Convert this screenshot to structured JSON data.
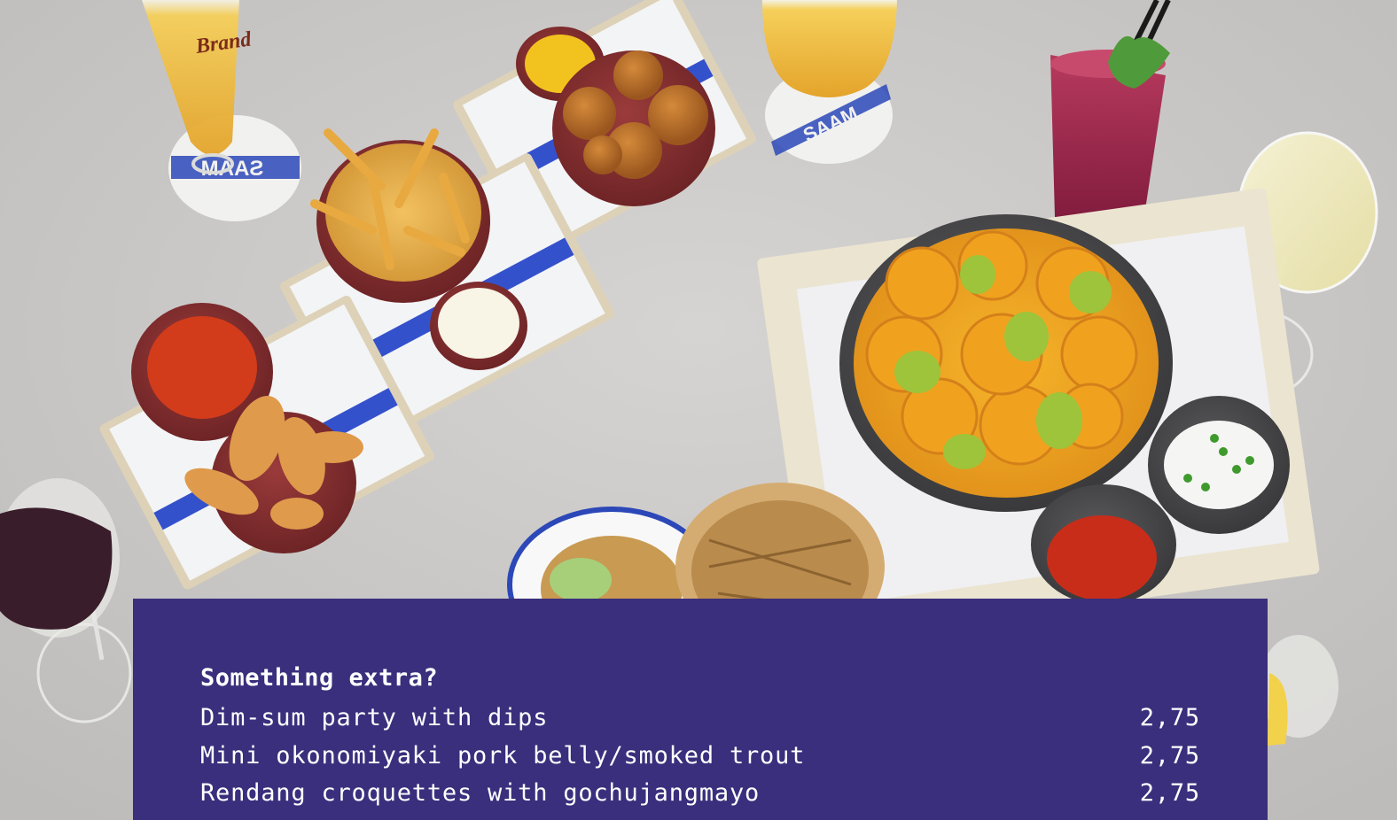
{
  "menu": {
    "heading": "Something extra?",
    "items": [
      {
        "name": "Dim-sum party with dips",
        "price": "2,75"
      },
      {
        "name": "Mini okonomiyaki pork belly/smoked trout",
        "price": "2,75"
      },
      {
        "name": "Rendang croquettes with gochujangmayo",
        "price": "2,75"
      }
    ]
  },
  "colors": {
    "panel": "#3a2f7c",
    "table_surface": "#c9c7c5",
    "accent_blue": "#1f3fc8"
  },
  "photo_labels": {
    "beer_glass": "Brand",
    "coaster": "SAAM"
  }
}
